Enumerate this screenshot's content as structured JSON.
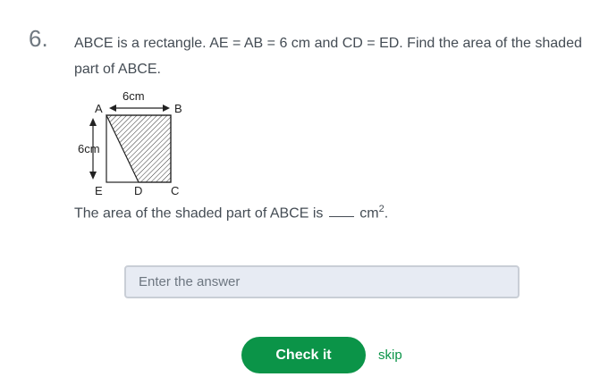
{
  "question": {
    "number": "6.",
    "text": "ABCE is a rectangle. AE = AB = 6 cm and CD = ED. Find the area of the shaded part of ABCE."
  },
  "figure": {
    "labels": {
      "A": "A",
      "B": "B",
      "C": "C",
      "D": "D",
      "E": "E",
      "top_measure": "6cm",
      "side_measure": "6cm"
    }
  },
  "answer_prompt": {
    "before": "The area of the shaded part of ABCE is",
    "unit": "cm",
    "exponent": "2",
    "after": "."
  },
  "answer_input": {
    "placeholder": "Enter the answer",
    "value": ""
  },
  "actions": {
    "check_label": "Check it",
    "skip_label": "skip"
  },
  "colors": {
    "accent": "#0b9448",
    "input_bg": "#e7ebf3",
    "text": "#444c54"
  }
}
